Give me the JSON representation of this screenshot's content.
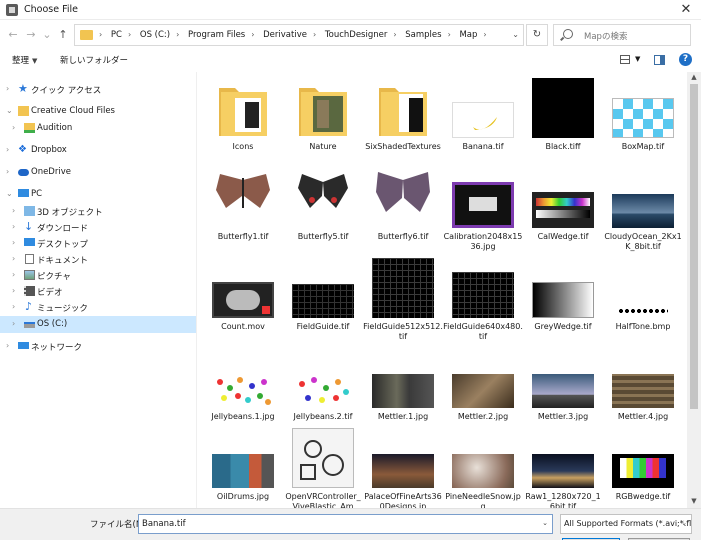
{
  "window": {
    "title": "Choose File",
    "close": "✕"
  },
  "nav": {
    "back": "←",
    "forward": "→",
    "up": "↑",
    "dropdown": "⌄",
    "refresh": "↻",
    "breadcrumbs": [
      "PC",
      "OS (C:)",
      "Program Files",
      "Derivative",
      "TouchDesigner",
      "Samples",
      "Map"
    ]
  },
  "search": {
    "placeholder": "Mapの検索"
  },
  "toolbar": {
    "organize": "整理",
    "new_folder": "新しいフォルダー",
    "help": "?"
  },
  "sidebar": {
    "quick_access": "クイック アクセス",
    "creative_cloud": "Creative Cloud Files",
    "audition": "Audition",
    "dropbox": "Dropbox",
    "onedrive": "OneDrive",
    "pc": "PC",
    "objects3d": "3D オブジェクト",
    "downloads": "ダウンロード",
    "desktop": "デスクトップ",
    "documents": "ドキュメント",
    "pictures": "ピクチャ",
    "videos": "ビデオ",
    "music": "ミュージック",
    "osc": "OS (C:)",
    "network": "ネットワーク"
  },
  "files": [
    {
      "name": "Icons",
      "icon": "folder-icon"
    },
    {
      "name": "Nature",
      "icon": "folder-icon"
    },
    {
      "name": "SixShadedTextures",
      "icon": "folder-icon"
    },
    {
      "name": "Banana.tif",
      "icon": "image-thumbnail"
    },
    {
      "name": "Black.tiff",
      "icon": "image-thumbnail"
    },
    {
      "name": "BoxMap.tif",
      "icon": "image-thumbnail"
    },
    {
      "name": "Butterfly1.tif",
      "icon": "image-thumbnail"
    },
    {
      "name": "Butterfly5.tif",
      "icon": "image-thumbnail"
    },
    {
      "name": "Butterfly6.tif",
      "icon": "image-thumbnail"
    },
    {
      "name": "Calibration2048x1536.jpg",
      "icon": "image-thumbnail"
    },
    {
      "name": "CalWedge.tif",
      "icon": "image-thumbnail"
    },
    {
      "name": "CloudyOcean_2Kx1K_8bit.tif",
      "icon": "image-thumbnail"
    },
    {
      "name": "Count.mov",
      "icon": "video-thumbnail"
    },
    {
      "name": "FieldGuide.tif",
      "icon": "image-thumbnail"
    },
    {
      "name": "FieldGuide512x512.tif",
      "icon": "image-thumbnail"
    },
    {
      "name": "FieldGuide640x480.tif",
      "icon": "image-thumbnail"
    },
    {
      "name": "GreyWedge.tif",
      "icon": "image-thumbnail"
    },
    {
      "name": "HalfTone.bmp",
      "icon": "image-thumbnail"
    },
    {
      "name": "Jellybeans.1.jpg",
      "icon": "image-thumbnail"
    },
    {
      "name": "Jellybeans.2.tif",
      "icon": "image-thumbnail"
    },
    {
      "name": "Mettler.1.jpg",
      "icon": "image-thumbnail"
    },
    {
      "name": "Mettler.2.jpg",
      "icon": "image-thumbnail"
    },
    {
      "name": "Mettler.3.jpg",
      "icon": "image-thumbnail"
    },
    {
      "name": "Mettler.4.jpg",
      "icon": "image-thumbnail"
    },
    {
      "name": "OilDrums.jpg",
      "icon": "image-thumbnail"
    },
    {
      "name": "OpenVRController_ViveBlastic_Am",
      "icon": "image-thumbnail"
    },
    {
      "name": "PalaceOfFineArts360Designs.jp",
      "icon": "image-thumbnail"
    },
    {
      "name": "PineNeedleSnow.jpg",
      "icon": "image-thumbnail"
    },
    {
      "name": "Raw1_1280x720_16bit.tif",
      "icon": "image-thumbnail"
    },
    {
      "name": "RGBwedge.tif",
      "icon": "image-thumbnail"
    }
  ],
  "bottom": {
    "filename_label": "ファイル名(N):",
    "filename_value": "Banana.tif",
    "filetype_value": "All Supported Formats (*.avi;*.fl",
    "dropdown": "⌄"
  },
  "scroll": {
    "up": "▲",
    "down": "▼"
  },
  "colors": {
    "accent": "#1f6fc6",
    "selection": "#cce8ff",
    "folder": "#f2c451"
  }
}
